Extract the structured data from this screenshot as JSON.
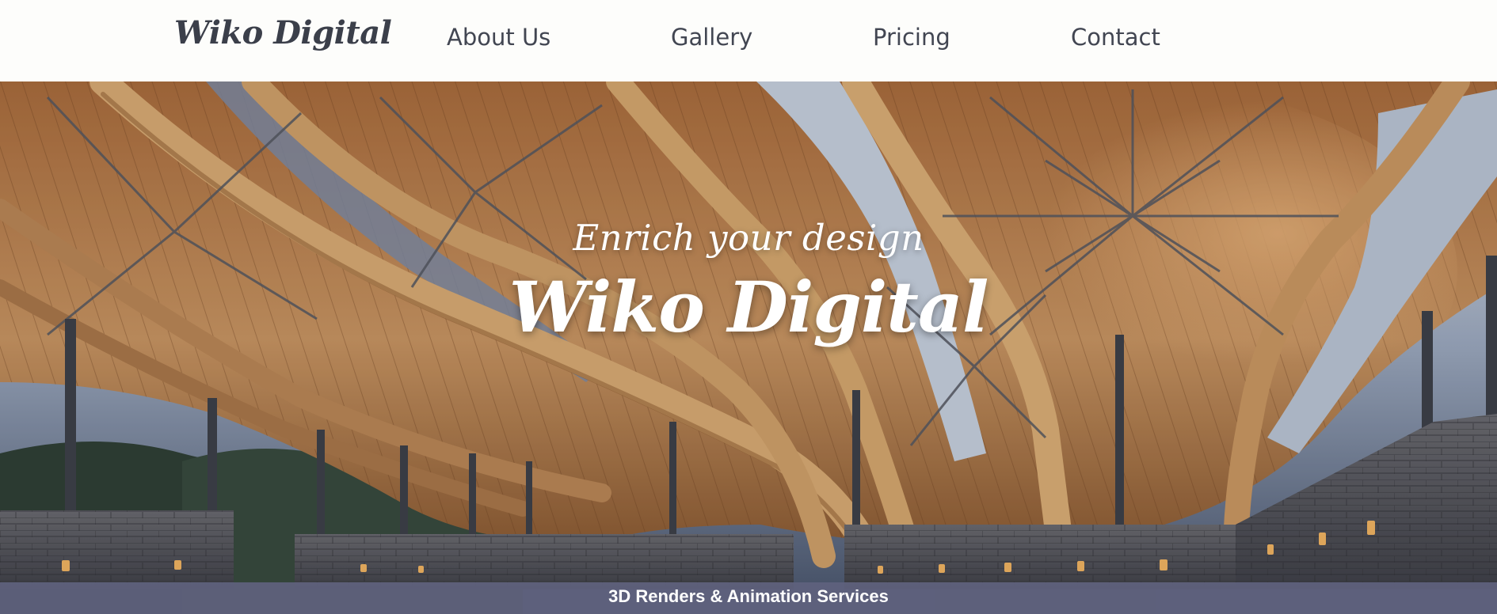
{
  "header": {
    "logo_text": "Wiko Digital",
    "nav": {
      "about": "About Us",
      "gallery": "Gallery",
      "pricing": "Pricing",
      "contact": "Contact"
    }
  },
  "hero": {
    "tagline": "Enrich your design",
    "title": "Wiko Digital",
    "banner_text": "3D Renders & Animation Services"
  },
  "colors": {
    "header_bg": "#fdfdfb",
    "text_dark": "#3b3f4a",
    "banner_bg": "#60627e",
    "wood": "#b9814f"
  }
}
